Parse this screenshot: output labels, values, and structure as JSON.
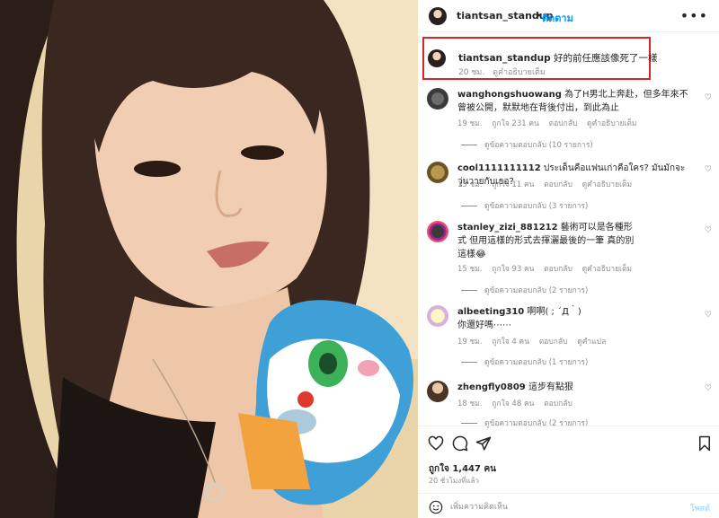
{
  "post": {
    "username": "tiantsan_standup",
    "separator": "•",
    "follow_label": "ติดตาม",
    "more_label": "•••"
  },
  "caption": {
    "username": "tiantsan_standup",
    "text": "好的前任應該像死了一樣",
    "time": "20 ชม.",
    "translate_label": "ดูคำอธิบายเต็ม"
  },
  "comments": [
    {
      "username": "wanghongshuowang",
      "text": "為了H男北上奔赴，但多年來不曾被公開，默默地在背後付出，到此為止",
      "meta": [
        "19 ชม.",
        "ถูกใจ 231 คน",
        "ตอบกลับ",
        "ดูคำอธิบายเต็ม"
      ],
      "replies": "ดูข้อความตอบกลับ (10 รายการ)"
    },
    {
      "username": "cool1111111112",
      "text": "ประเด็นคือแฟนเก่าคือใคร? มันมักจะวุ่นวายกับเธอ?",
      "meta": [
        "15 ชม.",
        "ถูกใจ 11 คน",
        "ตอบกลับ",
        "ดูคำอธิบายเต็ม"
      ],
      "replies": "ดูข้อความตอบกลับ (3 รายการ)"
    },
    {
      "username": "stanley_zizi_881212",
      "text": "藝術可以是各種形式 但用這樣的形式去揮灑最後的一筆 真的別這樣😂",
      "meta": [
        "15 ชม.",
        "ถูกใจ 93 คน",
        "ตอบกลับ",
        "ดูคำอธิบายเต็ม"
      ],
      "replies": "ดูข้อความตอบกลับ (2 รายการ)"
    },
    {
      "username": "albeeting310",
      "text": "啊啊( ; ´Д｀) 你還好嗎⋯⋯",
      "meta": [
        "19 ชม.",
        "ถูกใจ 4 คน",
        "ตอบกลับ",
        "ดูคำแปล"
      ],
      "replies": "ดูข้อความตอบกลับ (1 รายการ)"
    },
    {
      "username": "zhengfly0809",
      "text": "這步有點狠",
      "meta": [
        "18 ชม.",
        "ถูกใจ 48 คน",
        "ตอบกลับ"
      ],
      "replies": "ดูข้อความตอบกลับ (2 รายการ)"
    }
  ],
  "actions": {
    "likes": "ถูกใจ 1,447 คน",
    "time": "20 ชั่วโมงที่แล้ว",
    "comment_placeholder": "เพิ่มความคิดเห็น",
    "post_label": "โพสต์"
  },
  "colors": {
    "accent": "#0095f6",
    "highlight_border": "#d6262a",
    "muted": "#8e8e8e"
  }
}
